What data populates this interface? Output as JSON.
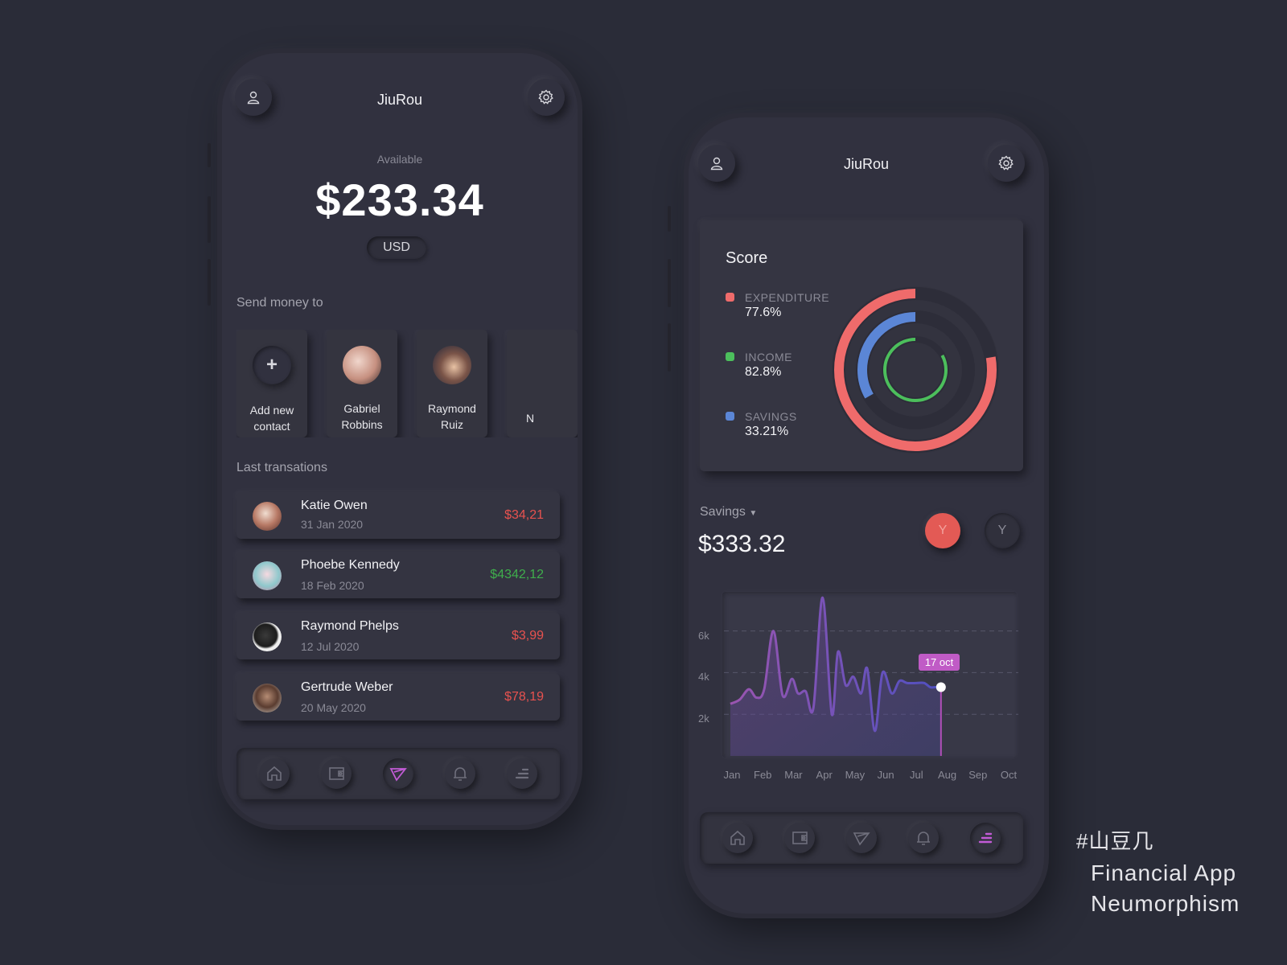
{
  "left_phone": {
    "header": {
      "title": "JiuRou",
      "profile_icon": "user-icon",
      "settings_icon": "gear-icon"
    },
    "balance": {
      "label": "Available",
      "amount": "$233.34",
      "currency": "USD"
    },
    "send_money": {
      "title": "Send money to",
      "contacts": [
        {
          "label_line1": "Add new",
          "label_line2": "contact",
          "icon": "plus-icon"
        },
        {
          "label_line1": "Gabriel",
          "label_line2": "Robbins"
        },
        {
          "label_line1": "Raymond",
          "label_line2": "Ruiz"
        },
        {
          "label_line1": "N",
          "label_line2": ""
        }
      ]
    },
    "transactions": {
      "title": "Last transations",
      "items": [
        {
          "name": "Katie Owen",
          "date": "31 Jan 2020",
          "amount": "$34,21",
          "type": "debit"
        },
        {
          "name": "Phoebe Kennedy",
          "date": "18 Feb 2020",
          "amount": "$4342,12",
          "type": "credit"
        },
        {
          "name": "Raymond Phelps",
          "date": "12 Jul 2020",
          "amount": "$3,99",
          "type": "debit"
        },
        {
          "name": "Gertrude Weber",
          "date": "20 May 2020",
          "amount": "$78,19",
          "type": "debit"
        }
      ]
    },
    "nav": {
      "items": [
        "home-icon",
        "wallet-icon",
        "send-icon",
        "bell-icon",
        "menu-icon"
      ],
      "active": "send-icon"
    }
  },
  "right_phone": {
    "header": {
      "title": "JiuRou",
      "profile_icon": "user-icon",
      "settings_icon": "gear-icon"
    },
    "score": {
      "title": "Score",
      "items": [
        {
          "label": "EXPENDITURE",
          "value": "77.6%",
          "percent": 77.6,
          "color": "#ef6b6b"
        },
        {
          "label": "INCOME",
          "value": "82.8%",
          "percent": 82.8,
          "color": "#4cbf5c"
        },
        {
          "label": "SAVINGS",
          "value": "33.21%",
          "percent": 33.21,
          "color": "#5b86d6"
        }
      ]
    },
    "savings": {
      "dropdown_label": "Savings",
      "amount": "$333.32",
      "toggle_active": "Y",
      "toggle_inactive": "Y"
    },
    "nav": {
      "items": [
        "home-icon",
        "wallet-icon",
        "send-icon",
        "bell-icon",
        "menu-icon"
      ],
      "active": "menu-icon"
    }
  },
  "chart_data": {
    "type": "area",
    "title": "Savings",
    "x_ticks": [
      "Jan",
      "Feb",
      "Mar",
      "Apr",
      "May",
      "Jun",
      "Jul",
      "Aug",
      "Sep",
      "Oct"
    ],
    "y_ticks": [
      "2k",
      "4k",
      "6k"
    ],
    "ylim": [
      0,
      7800
    ],
    "grid": true,
    "series": [
      {
        "name": "Savings",
        "x": [
          0,
          0.3,
          0.6,
          0.85,
          1.1,
          1.4,
          1.7,
          2.0,
          2.2,
          2.45,
          2.7,
          3.0,
          3.3,
          3.5,
          3.75,
          4.0,
          4.25,
          4.45,
          4.7,
          4.95,
          5.25,
          5.5,
          5.75,
          6.05,
          6.3,
          6.5,
          6.65,
          6.85
        ],
        "y": [
          2500,
          2700,
          3200,
          2800,
          3200,
          6000,
          2900,
          3700,
          3000,
          3100,
          2300,
          7600,
          2000,
          5000,
          3400,
          3800,
          3000,
          4200,
          1200,
          4000,
          3000,
          3600,
          3500,
          3500,
          3500,
          3300,
          3300,
          3300
        ]
      }
    ],
    "tooltip": {
      "label": "17 oct",
      "value_index": 27
    }
  },
  "caption": {
    "tag": "#山豆几",
    "line1": "Financial App",
    "line2": "Neumorphism"
  }
}
